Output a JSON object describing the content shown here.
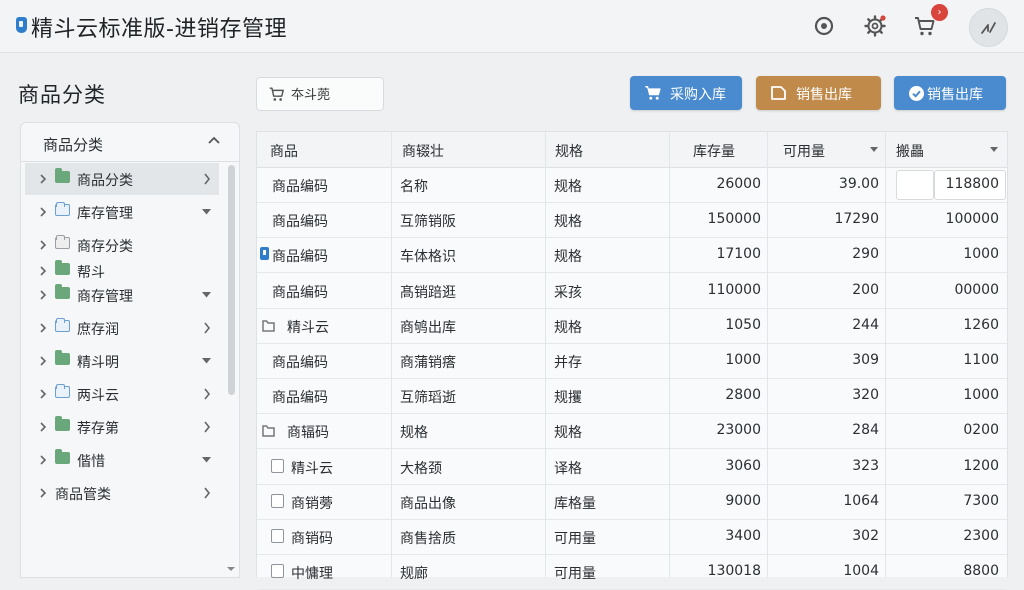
{
  "header": {
    "title": "精斗云标准版-进销存管理",
    "icons": [
      "settings-badge-icon",
      "gear-icon",
      "cart-icon",
      "user-avatar"
    ],
    "cart_badge": "›"
  },
  "sidebar": {
    "section_title": "商品分类",
    "panel_title": "商品分类",
    "items": [
      {
        "label": "商品分类",
        "folder": "green",
        "tail": "chevron-right",
        "selected": true
      },
      {
        "label": "库存管理",
        "folder": "blue",
        "tail": "caret-down",
        "selected": false
      },
      {
        "label": "商存分类",
        "folder": "gray",
        "tail": "",
        "selected": false
      },
      {
        "label": "帮斗",
        "folder": "green",
        "tail": "",
        "selected": false
      },
      {
        "label": "商存管理",
        "folder": "green",
        "tail": "caret-down",
        "selected": false
      },
      {
        "label": "庶存润",
        "folder": "blue",
        "tail": "chevron-right",
        "selected": false
      },
      {
        "label": "精斗明",
        "folder": "green",
        "tail": "caret-down",
        "selected": false
      },
      {
        "label": "两斗云",
        "folder": "blue",
        "tail": "chevron-right",
        "selected": false
      },
      {
        "label": "荐存第",
        "folder": "green",
        "tail": "chevron-right",
        "selected": false
      },
      {
        "label": "偕惜",
        "folder": "green",
        "tail": "caret-down",
        "selected": false
      },
      {
        "label": "商品管类",
        "folder": "",
        "tail": "chevron-right",
        "selected": false
      }
    ]
  },
  "toolbar": {
    "search_value": "夲斗蔸",
    "buttons": [
      {
        "label": "采购入库",
        "color": "#4a8bd0",
        "icon": "cart-icon"
      },
      {
        "label": "销售出库",
        "color": "#c08a4b",
        "icon": "document-icon"
      },
      {
        "label": "销售出库",
        "color": "#4a8bd0",
        "icon": "check-circle-icon"
      }
    ]
  },
  "table": {
    "columns": [
      "商品",
      "商辍壮",
      "规格",
      "库存量",
      "可用量",
      "搬畾"
    ],
    "rows": [
      {
        "c0": "商品编码",
        "c1": "名称",
        "c2": "规格",
        "c3": "26000",
        "c4": "39.00",
        "c5": "118800",
        "icon": ""
      },
      {
        "c0": "商品编码",
        "c1": "互筛销阪",
        "c2": "规格",
        "c3": "150000",
        "c4": "17290",
        "c5": "100000",
        "icon": ""
      },
      {
        "c0": "商品编码",
        "c1": "车体格识",
        "c2": "规格",
        "c3": "17100",
        "c4": "290",
        "c5": "1000",
        "icon": "tag"
      },
      {
        "c0": "商品编码",
        "c1": "髙销踣逛",
        "c2": "采孩",
        "c3": "110000",
        "c4": "200",
        "c5": "00000",
        "icon": ""
      },
      {
        "c0": "精斗云",
        "c1": "商鸲出库",
        "c2": "规格",
        "c3": "1050",
        "c4": "244",
        "c5": "1260",
        "icon": "folder"
      },
      {
        "c0": "商品编码",
        "c1": "商蒲销瘩",
        "c2": "并存",
        "c3": "1000",
        "c4": "309",
        "c5": "1100",
        "icon": ""
      },
      {
        "c0": "商品编码",
        "c1": "互筛瑫逝",
        "c2": "规攫",
        "c3": "2800",
        "c4": "320",
        "c5": "1000",
        "icon": ""
      },
      {
        "c0": "商辐码",
        "c1": "规格",
        "c2": "规格",
        "c3": "23000",
        "c4": "284",
        "c5": "0200",
        "icon": "folder"
      },
      {
        "c0": "精斗云",
        "c1": "大格颈",
        "c2": "译格",
        "c3": "3060",
        "c4": "323",
        "c5": "1200",
        "icon": "checkbox"
      },
      {
        "c0": "商销蒡",
        "c1": "商品出像",
        "c2": "库格量",
        "c3": "9000",
        "c4": "1064",
        "c5": "7300",
        "icon": "checkbox"
      },
      {
        "c0": "商销码",
        "c1": "商售捨质",
        "c2": "可用量",
        "c3": "3400",
        "c4": "302",
        "c5": "2300",
        "icon": "checkbox"
      },
      {
        "c0": "中慵理",
        "c1": "规廊",
        "c2": "可用量",
        "c3": "130018",
        "c4": "1004",
        "c5": "8800",
        "icon": "checkbox"
      }
    ]
  }
}
